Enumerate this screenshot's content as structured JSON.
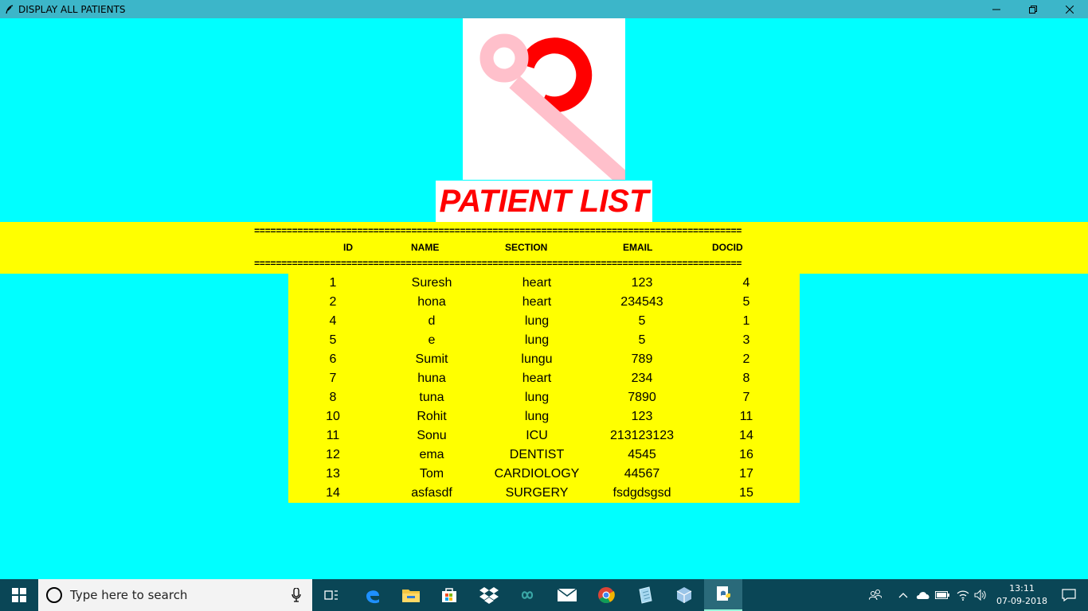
{
  "window": {
    "title": "DISPLAY ALL PATIENTS",
    "minimize": "—",
    "restore": "❐",
    "close": "✕"
  },
  "page": {
    "title": "PATIENT LIST",
    "rule": "=========================================================================================="
  },
  "table": {
    "headers": [
      "ID",
      "NAME",
      "SECTION",
      "EMAIL",
      "DOCID"
    ],
    "rows": [
      [
        "1",
        "Suresh",
        "heart",
        "123",
        "4"
      ],
      [
        "2",
        "hona",
        "heart",
        "234543",
        "5"
      ],
      [
        "4",
        "d",
        "lung",
        "5",
        "1"
      ],
      [
        "5",
        "e",
        "lung",
        "5",
        "3"
      ],
      [
        "6",
        "Sumit",
        "lungu",
        "789",
        "2"
      ],
      [
        "7",
        "huna",
        "heart",
        "234",
        "8"
      ],
      [
        "8",
        "tuna",
        "lung",
        "7890",
        "7"
      ],
      [
        "10",
        "Rohit",
        "lung",
        "123",
        "11"
      ],
      [
        "11",
        "Sonu",
        "ICU",
        "213123123",
        "14"
      ],
      [
        "12",
        "ema",
        "DENTIST",
        "4545",
        "16"
      ],
      [
        "13",
        "Tom",
        "CARDIOLOGY",
        "44567",
        "17"
      ],
      [
        "14",
        "asfasdf",
        "SURGERY",
        "fsdgdsgsd",
        "15"
      ]
    ]
  },
  "taskbar": {
    "search_placeholder": "Type here to search",
    "time": "13:11",
    "date": "07-09-2018",
    "icons": [
      "task-view-icon",
      "edge-icon",
      "file-explorer-icon",
      "store-icon",
      "dropbox-icon",
      "arduino-icon",
      "mail-icon",
      "chrome-icon",
      "notepad-icon",
      "virtualbox-icon",
      "python-idle-icon"
    ]
  },
  "colors": {
    "background": "#00ffff",
    "band": "#ffff00",
    "title_text": "#ff0000",
    "titlebar": "#3cb6c9",
    "taskbar": "#0a4656"
  }
}
